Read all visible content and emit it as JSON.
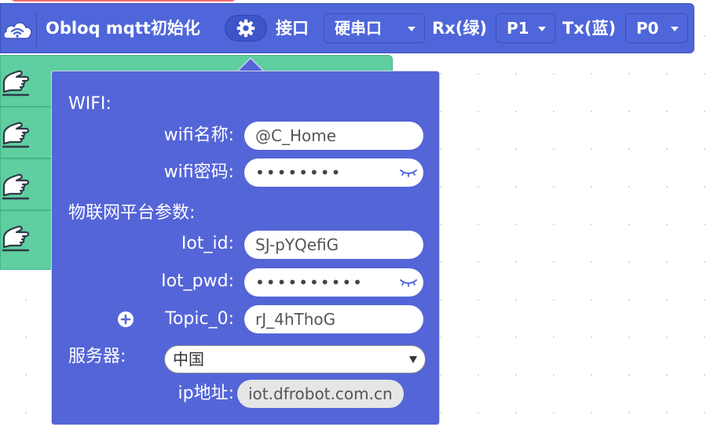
{
  "block": {
    "title": "Obloq mqtt初始化",
    "interface_label": "接口",
    "interface_value": "硬串口",
    "rx_label": "Rx(绿)",
    "rx_value": "P1",
    "tx_label": "Tx(蓝)",
    "tx_value": "P0",
    "icons": [
      "wifi-cloud-icon",
      "gear-icon",
      "chevron-down-icon"
    ],
    "colors": {
      "block_blue": "#4f66da",
      "popup_blue": "#5465d8",
      "green_block": "#5fcea0",
      "red_block": "#ef6b74"
    }
  },
  "popup": {
    "wifi_section": "WIFI:",
    "wifi_name_label": "wifi名称:",
    "wifi_name_value": "@C_Home",
    "wifi_pwd_label": "wifi密码:",
    "wifi_pwd_value": "••••••••",
    "iot_section": "物联网平台参数:",
    "iot_id_label": "Iot_id:",
    "iot_id_value": "SJ-pYQefiG",
    "iot_pwd_label": "Iot_pwd:",
    "iot_pwd_value": "••••••••••",
    "topic_label": "Topic_0:",
    "topic_value": "rJ_4hThoG",
    "server_label": "服务器:",
    "server_value": "中国",
    "ip_label": "ip地址:",
    "ip_value": "iot.dfrobot.com.cn",
    "icons": [
      "eye-closed-icon",
      "plus-icon",
      "dropdown-arrow-icon"
    ]
  }
}
